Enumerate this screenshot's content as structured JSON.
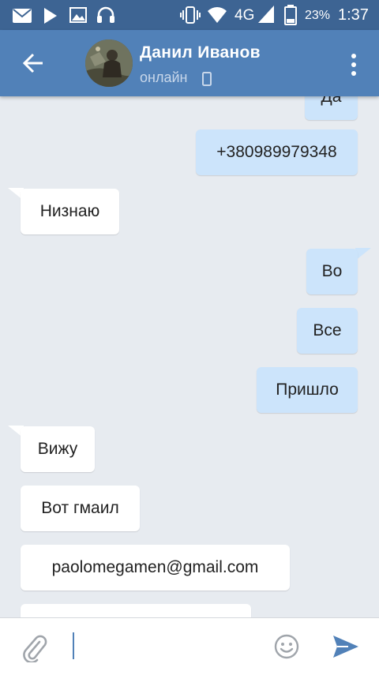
{
  "status_bar": {
    "battery_percent": "23%",
    "time": "1:37",
    "network": "4G"
  },
  "header": {
    "contact_name": "Данил Иванов",
    "contact_status": "онлайн"
  },
  "messages": [
    {
      "text": "Да",
      "direction": "out"
    },
    {
      "text": "+380989979348",
      "direction": "out"
    },
    {
      "text": "Низнаю",
      "direction": "in"
    },
    {
      "text": "Во",
      "direction": "out"
    },
    {
      "text": "Все",
      "direction": "out"
    },
    {
      "text": "Пришло",
      "direction": "out"
    },
    {
      "text": "Вижу",
      "direction": "in"
    },
    {
      "text": "Вот гмаил",
      "direction": "in"
    },
    {
      "text": "paolomegamen@gmail.com",
      "direction": "in"
    },
    {
      "text": "",
      "direction": "in"
    }
  ],
  "input": {
    "value": "",
    "placeholder": ""
  },
  "icons": {
    "status": [
      "mail-icon",
      "play-icon",
      "image-icon",
      "headset-icon",
      "vibrate-icon",
      "wifi-icon",
      "signal-icon",
      "battery-icon"
    ],
    "header": [
      "back-arrow-icon",
      "phone-icon",
      "more-vert-icon"
    ],
    "input": [
      "paperclip-icon",
      "emoji-icon",
      "send-icon"
    ]
  },
  "colors": {
    "status_bar": "#3d6493",
    "header": "#5181b8",
    "outgoing_bubble": "#cce4fb",
    "incoming_bubble": "#ffffff",
    "chat_background": "#e7ebf0"
  }
}
